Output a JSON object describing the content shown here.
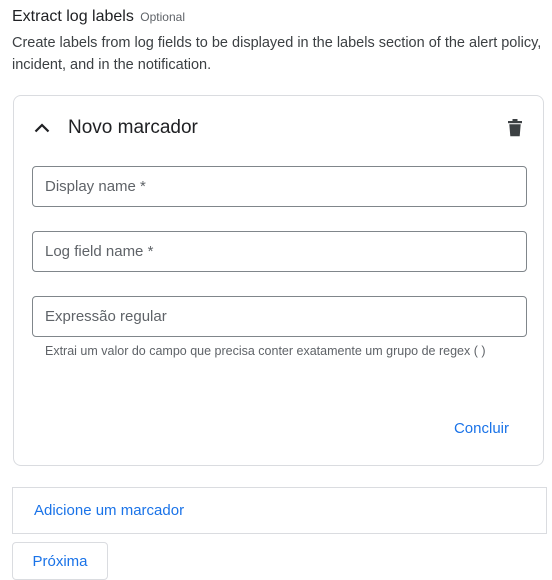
{
  "section": {
    "title": "Extract log labels",
    "optional_tag": "Optional",
    "description": "Create labels from log fields to be displayed in the labels section of the alert policy, incident, and in the notification."
  },
  "card": {
    "title": "Novo marcador",
    "collapse_icon": "chevron-up-icon",
    "delete_icon": "trash-icon",
    "fields": {
      "display_name": {
        "placeholder": "Display name *",
        "value": ""
      },
      "log_field_name": {
        "placeholder": "Log field name *",
        "value": ""
      },
      "regex": {
        "placeholder": "Expressão regular",
        "value": ""
      }
    },
    "regex_hint": "Extrai um valor do campo que precisa conter exatamente um grupo de regex ( )",
    "done_label": "Concluir"
  },
  "add_label": "Adicione um marcador",
  "next_label": "Próxima",
  "colors": {
    "accent": "#1a73e8",
    "border": "#dadce0",
    "text": "#202124",
    "secondary_text": "#5f6368"
  }
}
